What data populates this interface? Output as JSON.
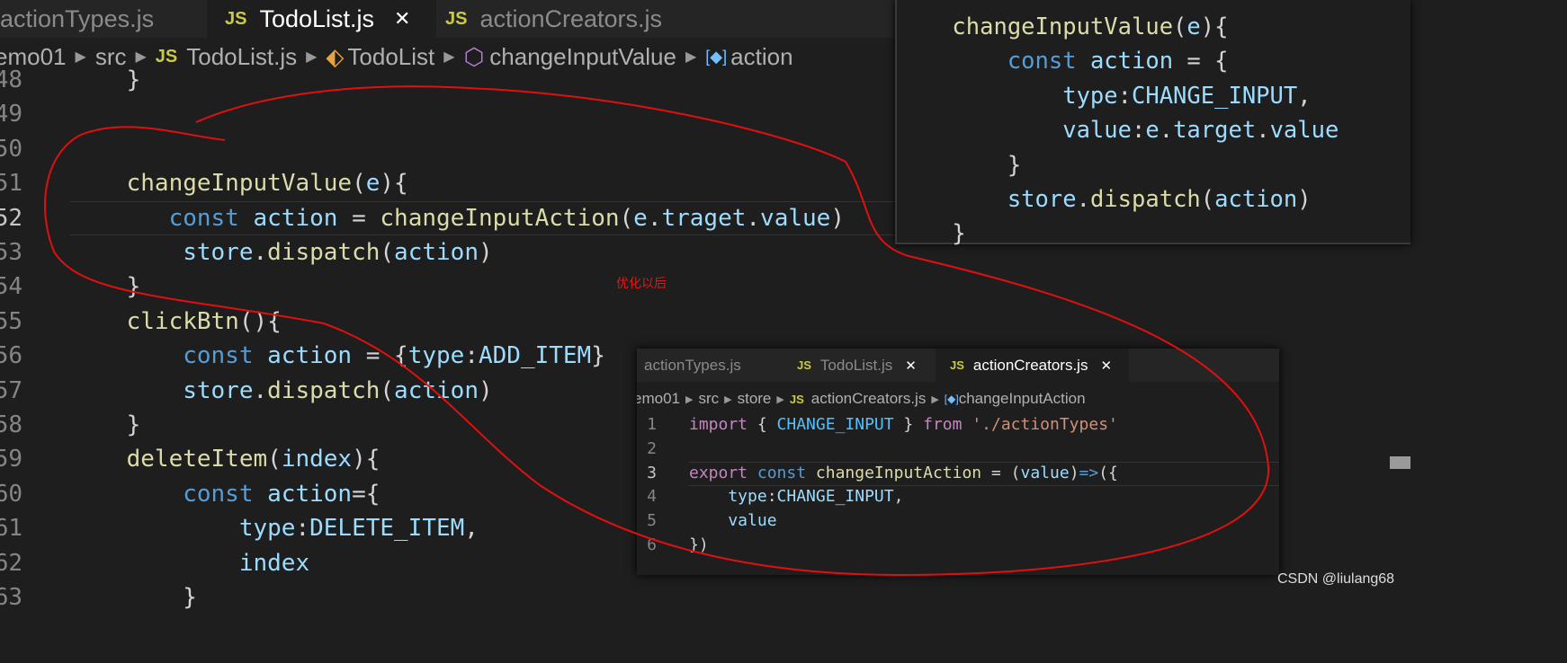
{
  "main": {
    "tabs": [
      {
        "label": "actionTypes.js",
        "active": false
      },
      {
        "label": "TodoList.js",
        "active": true,
        "icon": "js-icon",
        "close": "✕"
      },
      {
        "label": "actionCreators.js",
        "active": false,
        "icon": "js-icon"
      }
    ],
    "js_badge": "JS",
    "breadcrumb": [
      "emo01",
      "src",
      "TodoList.js",
      "TodoList",
      "changeInputValue",
      "action"
    ],
    "lines": [
      {
        "n": "48",
        "tokens": [
          [
            "    }",
            "pl"
          ]
        ]
      },
      {
        "n": "49",
        "tokens": []
      },
      {
        "n": "50",
        "tokens": []
      },
      {
        "n": "51",
        "tokens": [
          [
            "    changeInputValue",
            "fn"
          ],
          [
            "(",
            "pl"
          ],
          [
            "e",
            "vr"
          ],
          [
            "){",
            "pl"
          ]
        ]
      },
      {
        "n": "52",
        "tokens": [
          [
            "       const ",
            "kw"
          ],
          [
            "action",
            "vr"
          ],
          [
            " = ",
            "pl"
          ],
          [
            "changeInputAction",
            "fn"
          ],
          [
            "(",
            "pl"
          ],
          [
            "e",
            "vr"
          ],
          [
            ".",
            "pl"
          ],
          [
            "traget",
            "vr"
          ],
          [
            ".",
            "pl"
          ],
          [
            "value",
            "vr"
          ],
          [
            ")",
            "pl"
          ]
        ]
      },
      {
        "n": "53",
        "tokens": [
          [
            "        store",
            "vr"
          ],
          [
            ".",
            "pl"
          ],
          [
            "dispatch",
            "fn"
          ],
          [
            "(",
            "pl"
          ],
          [
            "action",
            "vr"
          ],
          [
            ")",
            "pl"
          ]
        ]
      },
      {
        "n": "54",
        "tokens": [
          [
            "    }",
            "pl"
          ]
        ]
      },
      {
        "n": "55",
        "tokens": [
          [
            "    clickBtn",
            "fn"
          ],
          [
            "(){",
            "pl"
          ]
        ]
      },
      {
        "n": "56",
        "tokens": [
          [
            "        const ",
            "kw"
          ],
          [
            "action",
            "vr"
          ],
          [
            " = {",
            "pl"
          ],
          [
            "type",
            "vr"
          ],
          [
            ":",
            "pl"
          ],
          [
            "ADD_ITEM",
            "vr"
          ],
          [
            "}",
            "pl"
          ]
        ]
      },
      {
        "n": "57",
        "tokens": [
          [
            "        store",
            "vr"
          ],
          [
            ".",
            "pl"
          ],
          [
            "dispatch",
            "fn"
          ],
          [
            "(",
            "pl"
          ],
          [
            "action",
            "vr"
          ],
          [
            ")",
            "pl"
          ]
        ]
      },
      {
        "n": "58",
        "tokens": [
          [
            "    }",
            "pl"
          ]
        ]
      },
      {
        "n": "59",
        "tokens": [
          [
            "    deleteItem",
            "fn"
          ],
          [
            "(",
            "pl"
          ],
          [
            "index",
            "vr"
          ],
          [
            "){",
            "pl"
          ]
        ]
      },
      {
        "n": "60",
        "tokens": [
          [
            "        const ",
            "kw"
          ],
          [
            "action",
            "vr"
          ],
          [
            "={",
            "pl"
          ]
        ]
      },
      {
        "n": "61",
        "tokens": [
          [
            "            type",
            "vr"
          ],
          [
            ":",
            "pl"
          ],
          [
            "DELETE_ITEM",
            "vr"
          ],
          [
            ",",
            "pl"
          ]
        ]
      },
      {
        "n": "62",
        "tokens": [
          [
            "            index",
            "vr"
          ]
        ]
      },
      {
        "n": "63",
        "tokens": [
          [
            "        }",
            "pl"
          ]
        ]
      }
    ]
  },
  "overlay": {
    "lines": [
      [
        [
          "    changeInputValue",
          "fn"
        ],
        [
          "(",
          "pl"
        ],
        [
          "e",
          "vr"
        ],
        [
          "){",
          "pl"
        ]
      ],
      [
        [
          "        const ",
          "kw"
        ],
        [
          "action",
          "vr"
        ],
        [
          " = {",
          "pl"
        ]
      ],
      [
        [
          "            type",
          "vr"
        ],
        [
          ":",
          "pl"
        ],
        [
          "CHANGE_INPUT",
          "vr"
        ],
        [
          ",",
          "pl"
        ]
      ],
      [
        [
          "            value",
          "vr"
        ],
        [
          ":",
          "pl"
        ],
        [
          "e",
          "vr"
        ],
        [
          ".",
          "pl"
        ],
        [
          "target",
          "vr"
        ],
        [
          ".",
          "pl"
        ],
        [
          "value",
          "vr"
        ]
      ],
      [
        [
          "        }",
          "pl"
        ]
      ],
      [
        [
          "        store",
          "vr"
        ],
        [
          ".",
          "pl"
        ],
        [
          "dispatch",
          "fn"
        ],
        [
          "(",
          "pl"
        ],
        [
          "action",
          "vr"
        ],
        [
          ")",
          "pl"
        ]
      ],
      [
        [
          "    }",
          "pl"
        ]
      ]
    ]
  },
  "annotation": {
    "text": "优化以后",
    "color": "#e01818"
  },
  "panel": {
    "tabs": [
      {
        "label": "actionTypes.js"
      },
      {
        "label": "TodoList.js",
        "close": "✕"
      },
      {
        "label": "actionCreators.js",
        "close": "✕",
        "active": true
      }
    ],
    "breadcrumb": [
      "emo01",
      "src",
      "store",
      "actionCreators.js",
      "changeInputAction"
    ],
    "lines": [
      {
        "n": "1",
        "tokens": [
          [
            "import",
            "pk"
          ],
          [
            " { ",
            "pl"
          ],
          [
            "CHANGE_INPUT",
            "ct"
          ],
          [
            " } ",
            "pl"
          ],
          [
            "from",
            "pk"
          ],
          [
            " ",
            "pl"
          ],
          [
            "'./actionTypes'",
            "st"
          ]
        ]
      },
      {
        "n": "2",
        "tokens": []
      },
      {
        "n": "3",
        "tokens": [
          [
            "export",
            "pk"
          ],
          [
            " ",
            "pl"
          ],
          [
            "const",
            "kw"
          ],
          [
            " ",
            "pl"
          ],
          [
            "changeInputAction",
            "fn"
          ],
          [
            " = (",
            "pl"
          ],
          [
            "value",
            "vr"
          ],
          [
            ")",
            "pl"
          ],
          [
            "=>",
            "kw"
          ],
          [
            "({",
            "pl"
          ]
        ]
      },
      {
        "n": "4",
        "tokens": [
          [
            "    type",
            "vr"
          ],
          [
            ":",
            "pl"
          ],
          [
            "CHANGE_INPUT",
            "vr"
          ],
          [
            ",",
            "pl"
          ]
        ]
      },
      {
        "n": "5",
        "tokens": [
          [
            "    value",
            "vr"
          ]
        ]
      },
      {
        "n": "6",
        "tokens": [
          [
            "})",
            "pl"
          ]
        ]
      }
    ]
  },
  "watermark": "CSDN @liulang68"
}
